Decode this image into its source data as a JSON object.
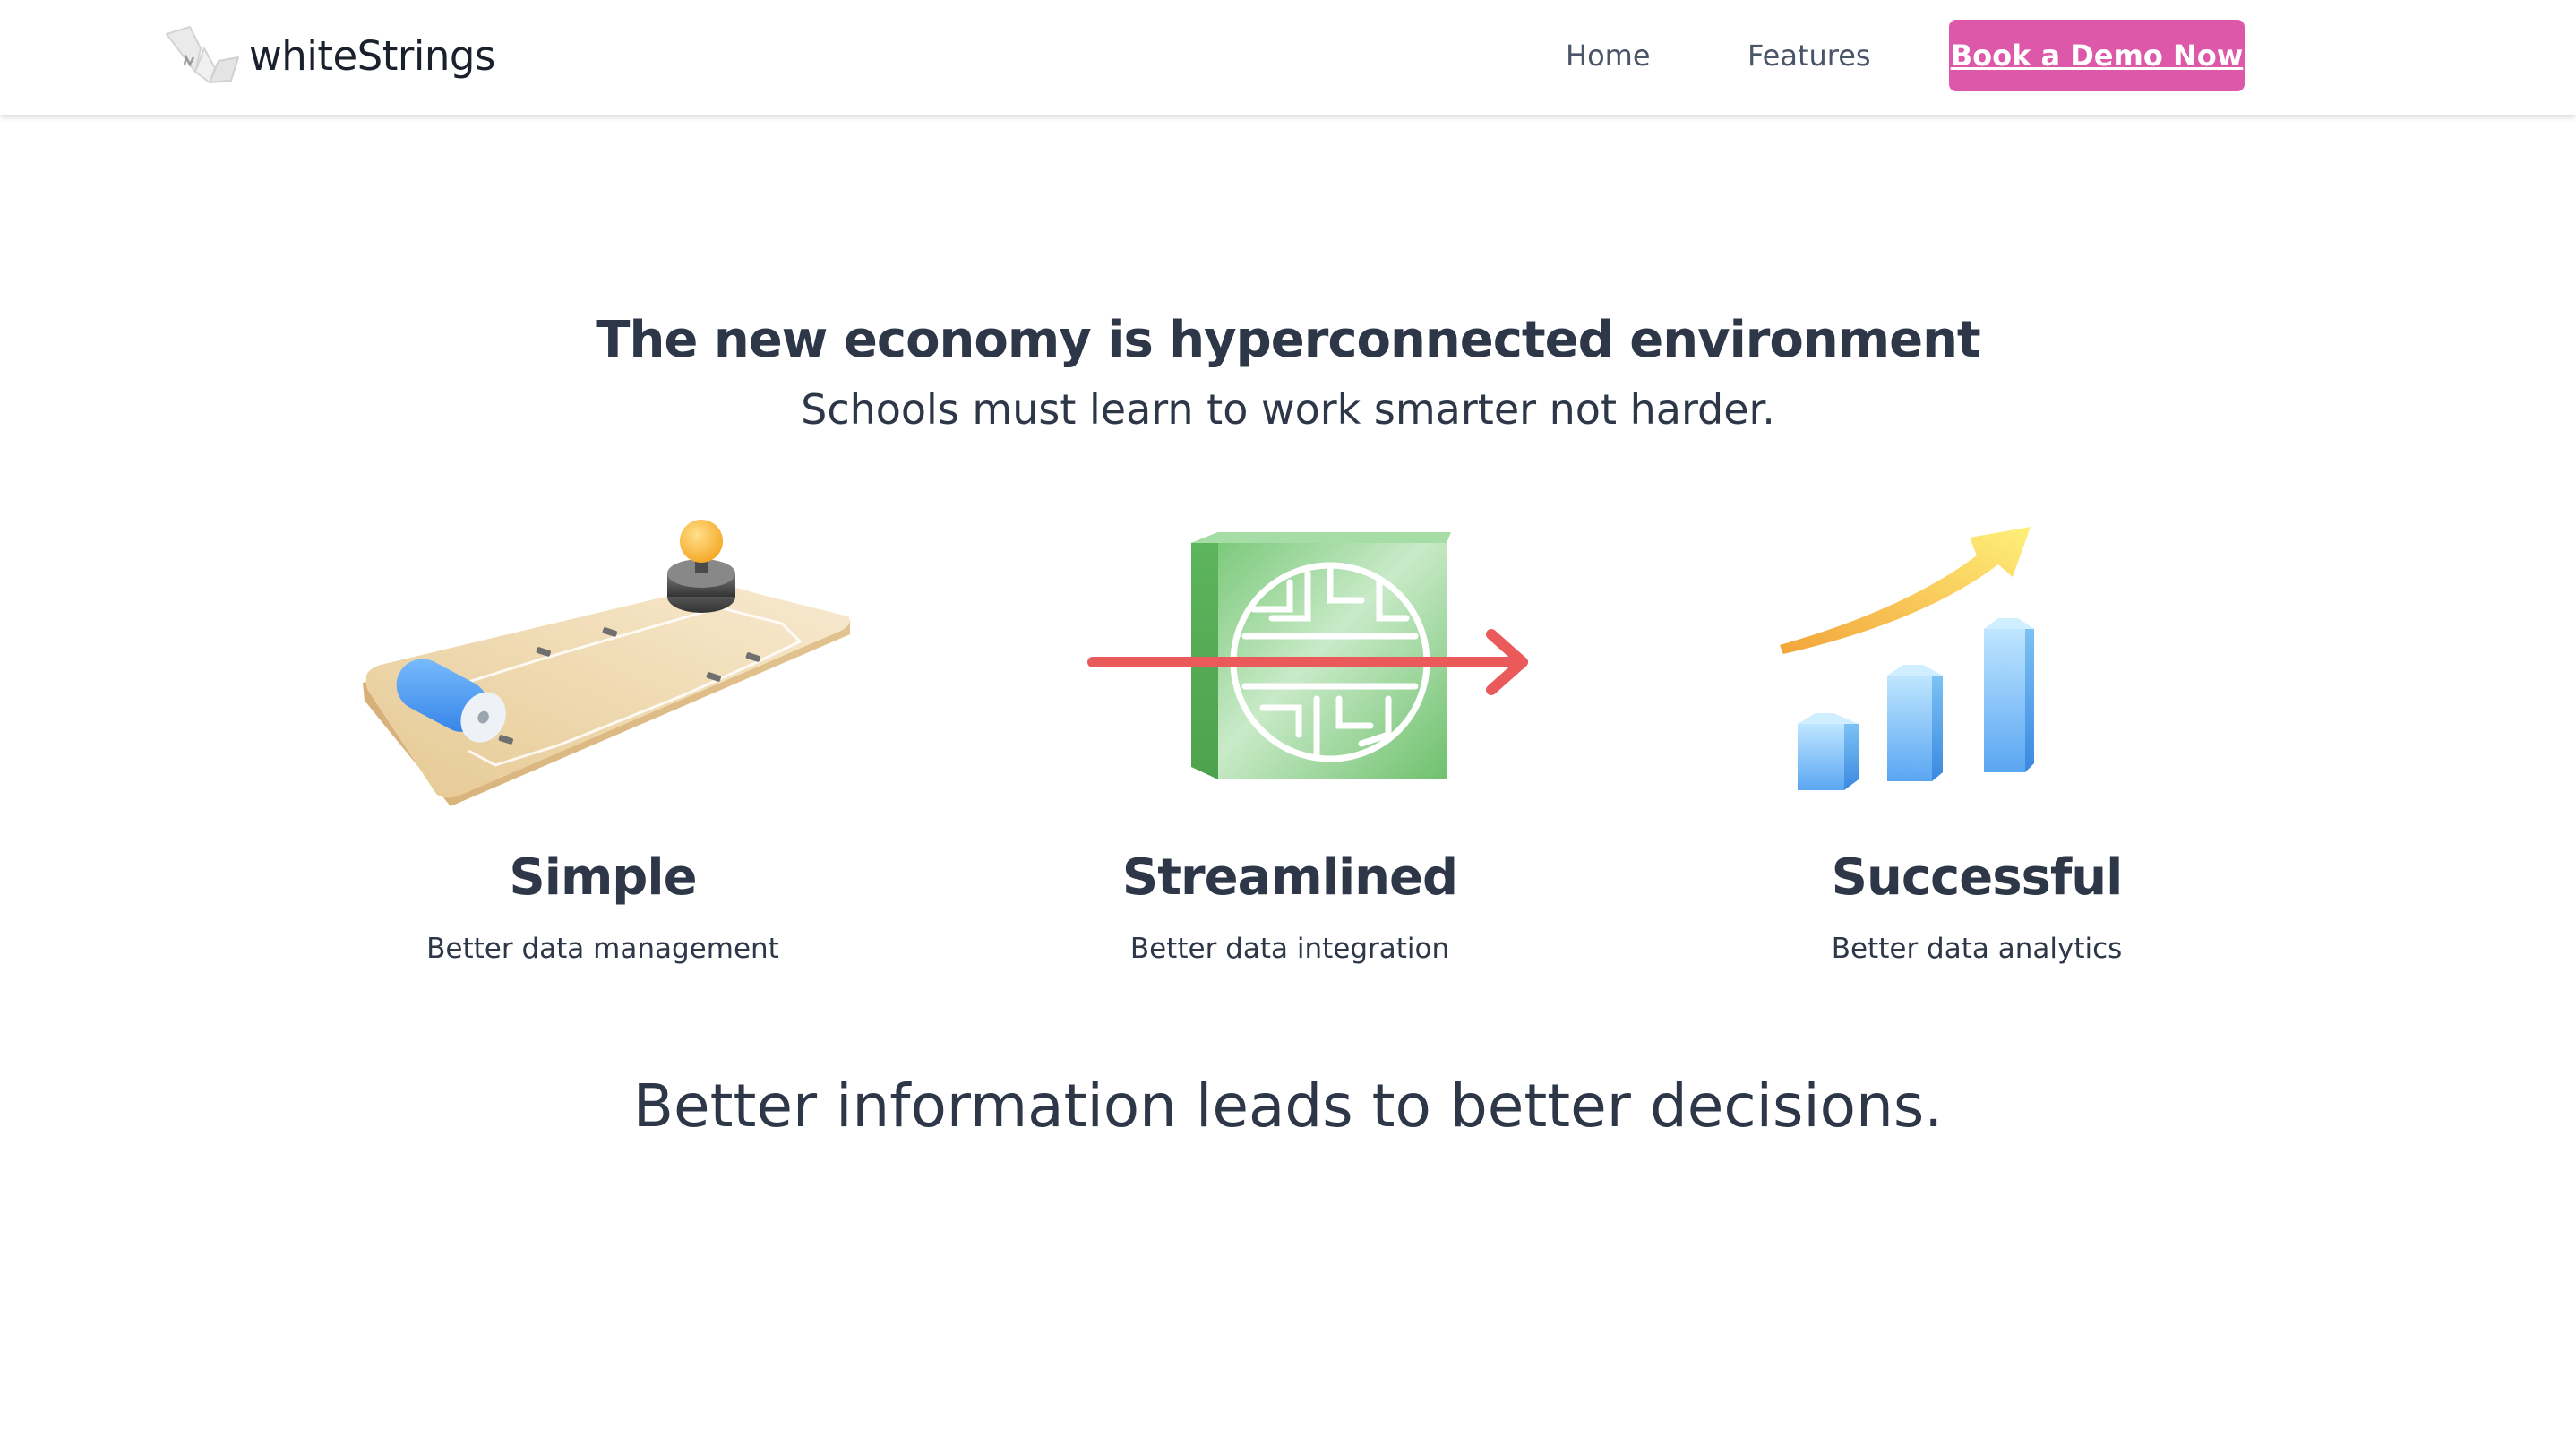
{
  "header": {
    "brand_name": "whiteStrings",
    "logo_icon": "whitestrings-logo-icon",
    "nav": {
      "home_label": "Home",
      "features_label": "Features"
    },
    "cta_label": "Book a Demo Now",
    "cta_color": "#de58a9"
  },
  "hero": {
    "headline": "The new economy is hyperconnected environment",
    "subline": "Schools must learn to work smarter not harder."
  },
  "features": [
    {
      "icon": "circuit-board-illustration",
      "title": "Simple",
      "description": "Better data management"
    },
    {
      "icon": "maze-cube-arrow-illustration",
      "title": "Streamlined",
      "description": "Better data integration"
    },
    {
      "icon": "growth-bar-chart-illustration",
      "title": "Successful",
      "description": "Better data analytics"
    }
  ],
  "closing": "Better information leads to better decisions."
}
